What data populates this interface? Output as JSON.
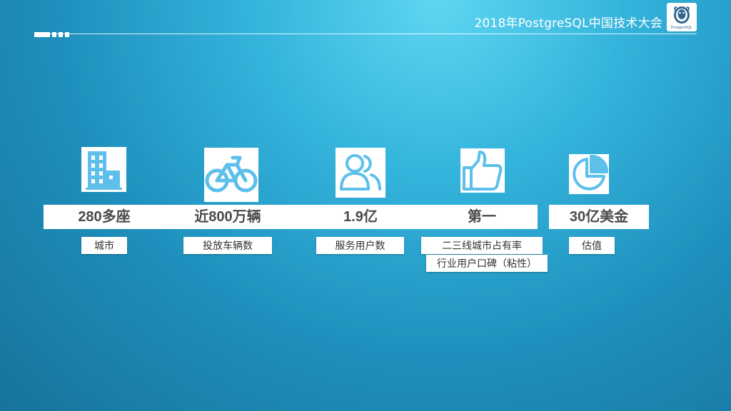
{
  "header": {
    "title": "2018年PostgreSQL中国技术大会",
    "logo_text": "PostgreSQL"
  },
  "colors": {
    "accent": "#5cc0ea",
    "label_text": "#333333",
    "stat_text": "#4a4a4a"
  },
  "stats": [
    {
      "icon": "building-icon",
      "value": "280多座",
      "labels": [
        "城市"
      ]
    },
    {
      "icon": "bicycle-icon",
      "value": "近800万辆",
      "labels": [
        "投放车辆数"
      ]
    },
    {
      "icon": "users-icon",
      "value": "1.9亿",
      "labels": [
        "服务用户数"
      ]
    },
    {
      "icon": "thumbs-up-icon",
      "value": "第一",
      "labels": [
        "二三线城市占有率",
        "行业用户口碑（粘性）"
      ]
    },
    {
      "icon": "pie-chart-icon",
      "value": "30亿美金",
      "labels": [
        "估值"
      ]
    }
  ]
}
